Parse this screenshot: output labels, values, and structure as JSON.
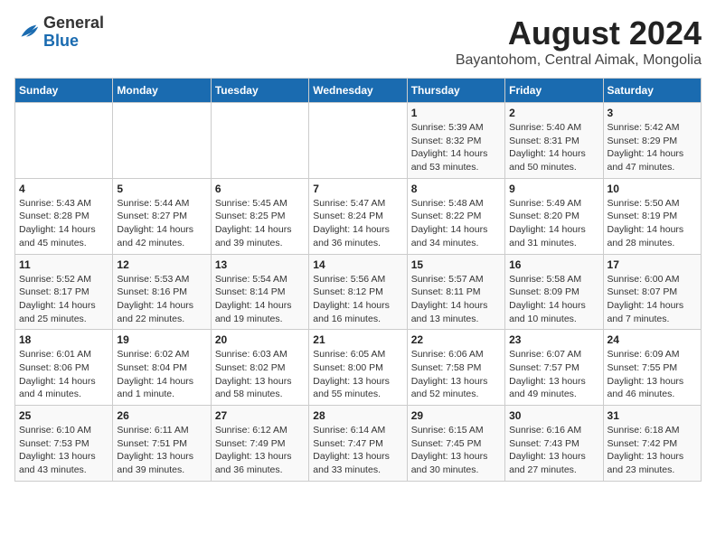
{
  "header": {
    "logo_general": "General",
    "logo_blue": "Blue",
    "title": "August 2024",
    "subtitle": "Bayantohom, Central Aimak, Mongolia"
  },
  "days_of_week": [
    "Sunday",
    "Monday",
    "Tuesday",
    "Wednesday",
    "Thursday",
    "Friday",
    "Saturday"
  ],
  "weeks": [
    [
      {
        "day": "",
        "info": ""
      },
      {
        "day": "",
        "info": ""
      },
      {
        "day": "",
        "info": ""
      },
      {
        "day": "",
        "info": ""
      },
      {
        "day": "1",
        "info": "Sunrise: 5:39 AM\nSunset: 8:32 PM\nDaylight: 14 hours\nand 53 minutes."
      },
      {
        "day": "2",
        "info": "Sunrise: 5:40 AM\nSunset: 8:31 PM\nDaylight: 14 hours\nand 50 minutes."
      },
      {
        "day": "3",
        "info": "Sunrise: 5:42 AM\nSunset: 8:29 PM\nDaylight: 14 hours\nand 47 minutes."
      }
    ],
    [
      {
        "day": "4",
        "info": "Sunrise: 5:43 AM\nSunset: 8:28 PM\nDaylight: 14 hours\nand 45 minutes."
      },
      {
        "day": "5",
        "info": "Sunrise: 5:44 AM\nSunset: 8:27 PM\nDaylight: 14 hours\nand 42 minutes."
      },
      {
        "day": "6",
        "info": "Sunrise: 5:45 AM\nSunset: 8:25 PM\nDaylight: 14 hours\nand 39 minutes."
      },
      {
        "day": "7",
        "info": "Sunrise: 5:47 AM\nSunset: 8:24 PM\nDaylight: 14 hours\nand 36 minutes."
      },
      {
        "day": "8",
        "info": "Sunrise: 5:48 AM\nSunset: 8:22 PM\nDaylight: 14 hours\nand 34 minutes."
      },
      {
        "day": "9",
        "info": "Sunrise: 5:49 AM\nSunset: 8:20 PM\nDaylight: 14 hours\nand 31 minutes."
      },
      {
        "day": "10",
        "info": "Sunrise: 5:50 AM\nSunset: 8:19 PM\nDaylight: 14 hours\nand 28 minutes."
      }
    ],
    [
      {
        "day": "11",
        "info": "Sunrise: 5:52 AM\nSunset: 8:17 PM\nDaylight: 14 hours\nand 25 minutes."
      },
      {
        "day": "12",
        "info": "Sunrise: 5:53 AM\nSunset: 8:16 PM\nDaylight: 14 hours\nand 22 minutes."
      },
      {
        "day": "13",
        "info": "Sunrise: 5:54 AM\nSunset: 8:14 PM\nDaylight: 14 hours\nand 19 minutes."
      },
      {
        "day": "14",
        "info": "Sunrise: 5:56 AM\nSunset: 8:12 PM\nDaylight: 14 hours\nand 16 minutes."
      },
      {
        "day": "15",
        "info": "Sunrise: 5:57 AM\nSunset: 8:11 PM\nDaylight: 14 hours\nand 13 minutes."
      },
      {
        "day": "16",
        "info": "Sunrise: 5:58 AM\nSunset: 8:09 PM\nDaylight: 14 hours\nand 10 minutes."
      },
      {
        "day": "17",
        "info": "Sunrise: 6:00 AM\nSunset: 8:07 PM\nDaylight: 14 hours\nand 7 minutes."
      }
    ],
    [
      {
        "day": "18",
        "info": "Sunrise: 6:01 AM\nSunset: 8:06 PM\nDaylight: 14 hours\nand 4 minutes."
      },
      {
        "day": "19",
        "info": "Sunrise: 6:02 AM\nSunset: 8:04 PM\nDaylight: 14 hours\nand 1 minute."
      },
      {
        "day": "20",
        "info": "Sunrise: 6:03 AM\nSunset: 8:02 PM\nDaylight: 13 hours\nand 58 minutes."
      },
      {
        "day": "21",
        "info": "Sunrise: 6:05 AM\nSunset: 8:00 PM\nDaylight: 13 hours\nand 55 minutes."
      },
      {
        "day": "22",
        "info": "Sunrise: 6:06 AM\nSunset: 7:58 PM\nDaylight: 13 hours\nand 52 minutes."
      },
      {
        "day": "23",
        "info": "Sunrise: 6:07 AM\nSunset: 7:57 PM\nDaylight: 13 hours\nand 49 minutes."
      },
      {
        "day": "24",
        "info": "Sunrise: 6:09 AM\nSunset: 7:55 PM\nDaylight: 13 hours\nand 46 minutes."
      }
    ],
    [
      {
        "day": "25",
        "info": "Sunrise: 6:10 AM\nSunset: 7:53 PM\nDaylight: 13 hours\nand 43 minutes."
      },
      {
        "day": "26",
        "info": "Sunrise: 6:11 AM\nSunset: 7:51 PM\nDaylight: 13 hours\nand 39 minutes."
      },
      {
        "day": "27",
        "info": "Sunrise: 6:12 AM\nSunset: 7:49 PM\nDaylight: 13 hours\nand 36 minutes."
      },
      {
        "day": "28",
        "info": "Sunrise: 6:14 AM\nSunset: 7:47 PM\nDaylight: 13 hours\nand 33 minutes."
      },
      {
        "day": "29",
        "info": "Sunrise: 6:15 AM\nSunset: 7:45 PM\nDaylight: 13 hours\nand 30 minutes."
      },
      {
        "day": "30",
        "info": "Sunrise: 6:16 AM\nSunset: 7:43 PM\nDaylight: 13 hours\nand 27 minutes."
      },
      {
        "day": "31",
        "info": "Sunrise: 6:18 AM\nSunset: 7:42 PM\nDaylight: 13 hours\nand 23 minutes."
      }
    ]
  ]
}
